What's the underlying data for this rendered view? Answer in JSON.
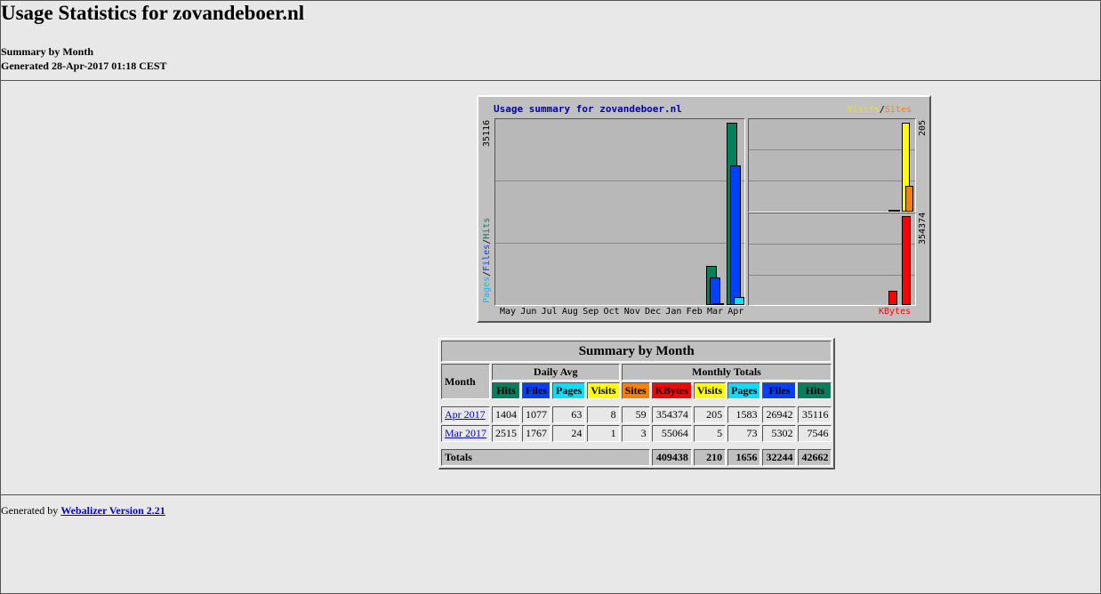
{
  "header": {
    "title": "Usage Statistics for zovandeboer.nl",
    "subtitle": "Summary by Month",
    "generated": "Generated 28-Apr-2017 01:18 CEST"
  },
  "chart": {
    "title": "Usage summary for zovandeboer.nl",
    "legend_visits": "Visits",
    "legend_slash": "/",
    "legend_sites": "Sites",
    "left_axis_pages": "Pages",
    "left_axis_files": "Files",
    "left_axis_hits": "Hits",
    "left_axis_sep": "/",
    "left_max": "35116",
    "right_top_max": "205",
    "right_bottom_max": "354374",
    "kbytes_label": "KBytes",
    "months": [
      "May",
      "Jun",
      "Jul",
      "Aug",
      "Sep",
      "Oct",
      "Nov",
      "Dec",
      "Jan",
      "Feb",
      "Mar",
      "Apr"
    ]
  },
  "chart_data": {
    "type": "bar",
    "categories": [
      "May",
      "Jun",
      "Jul",
      "Aug",
      "Sep",
      "Oct",
      "Nov",
      "Dec",
      "Jan",
      "Feb",
      "Mar",
      "Apr"
    ],
    "series": [
      {
        "name": "Hits",
        "values": [
          0,
          0,
          0,
          0,
          0,
          0,
          0,
          0,
          0,
          0,
          7546,
          35116
        ]
      },
      {
        "name": "Files",
        "values": [
          0,
          0,
          0,
          0,
          0,
          0,
          0,
          0,
          0,
          0,
          5302,
          26942
        ]
      },
      {
        "name": "Pages",
        "values": [
          0,
          0,
          0,
          0,
          0,
          0,
          0,
          0,
          0,
          0,
          73,
          1583
        ]
      },
      {
        "name": "Visits",
        "values": [
          0,
          0,
          0,
          0,
          0,
          0,
          0,
          0,
          0,
          0,
          5,
          205
        ]
      },
      {
        "name": "Sites",
        "values": [
          0,
          0,
          0,
          0,
          0,
          0,
          0,
          0,
          0,
          0,
          3,
          59
        ]
      },
      {
        "name": "KBytes",
        "values": [
          0,
          0,
          0,
          0,
          0,
          0,
          0,
          0,
          0,
          0,
          55064,
          354374
        ]
      }
    ],
    "colors": {
      "Hits": "#00805c",
      "Files": "#0040ff",
      "Pages": "#00e0ff",
      "Visits": "#ffff00",
      "Sites": "#ff8000",
      "KBytes": "#ff0000"
    }
  },
  "table": {
    "title": "Summary by Month",
    "month_header": "Month",
    "daily_avg_header": "Daily Avg",
    "monthly_totals_header": "Monthly Totals",
    "daily_cols": [
      "Hits",
      "Files",
      "Pages",
      "Visits"
    ],
    "monthly_cols": [
      "Sites",
      "KBytes",
      "Visits",
      "Pages",
      "Files",
      "Hits"
    ],
    "rows": [
      {
        "month": "Apr 2017",
        "daily": [
          "1404",
          "1077",
          "63",
          "8"
        ],
        "monthly": [
          "59",
          "354374",
          "205",
          "1583",
          "26942",
          "35116"
        ]
      },
      {
        "month": "Mar 2017",
        "daily": [
          "2515",
          "1767",
          "24",
          "1"
        ],
        "monthly": [
          "3",
          "55064",
          "5",
          "73",
          "5302",
          "7546"
        ]
      }
    ],
    "totals_label": "Totals",
    "totals": [
      "409438",
      "210",
      "1656",
      "32244",
      "42662"
    ]
  },
  "footer": {
    "prefix": "Generated by ",
    "link": "Webalizer Version 2.21"
  }
}
